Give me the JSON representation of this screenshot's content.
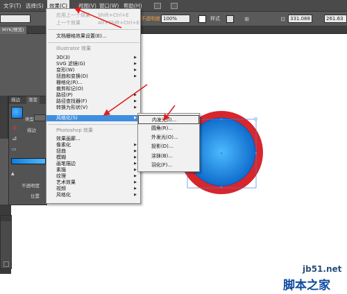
{
  "menubar": {
    "items": [
      "文字(T)",
      "选择(S)",
      "效果(C)",
      "视图(V)",
      "窗口(W)",
      "帮助(H)"
    ]
  },
  "controlbar": {
    "opacity_label": "不透明度",
    "opacity_value": "100%",
    "style_label": "样式",
    "x_value": "331.088",
    "w_value": "261.63"
  },
  "tabbar": {
    "doc_tab": "MYK/预览)"
  },
  "effect_menu": {
    "apply_last": "应用上一个效果",
    "apply_last_shortcut": "Shift+Ctrl+E",
    "last_effect": "上一个效果",
    "last_effect_shortcut": "Alt+Shift+Ctrl+E",
    "raster_settings": "文档栅格效果设置(E)...",
    "illustrator_header": "Illustrator 效果",
    "illustrator_items": [
      "3D(3)",
      "SVG 滤镜(G)",
      "变形(W)",
      "扭曲和变换(D)",
      "栅格化(R)...",
      "裁剪标记(O)",
      "路径(P)",
      "路径查找器(F)",
      "转换为形状(V)",
      "风格化(S)"
    ],
    "photoshop_header": "Photoshop 效果",
    "photoshop_items": [
      "效果画廊...",
      "像素化",
      "扭曲",
      "模糊",
      "画笔描边",
      "素描",
      "纹理",
      "艺术效果",
      "视频",
      "风格化"
    ]
  },
  "stylize_submenu": {
    "items": [
      "内发光(I)...",
      "圆角(R)...",
      "外发光(O)...",
      "投影(D)...",
      "涂抹(B)...",
      "羽化(F)..."
    ]
  },
  "left_panel": {
    "tabs": [
      "描边",
      "渐变"
    ],
    "type_label": "类型",
    "stroke_label": "描边",
    "opacity_label": "不透明度",
    "position_label": "位置"
  },
  "watermark": {
    "site": "jb51.net",
    "name": "脚本之家"
  },
  "colors": {
    "menu_highlight": "#3f8ee0",
    "circle_outer": "#d8262b",
    "circle_inner": "#1b88e0",
    "arrow": "#e21c1c"
  }
}
